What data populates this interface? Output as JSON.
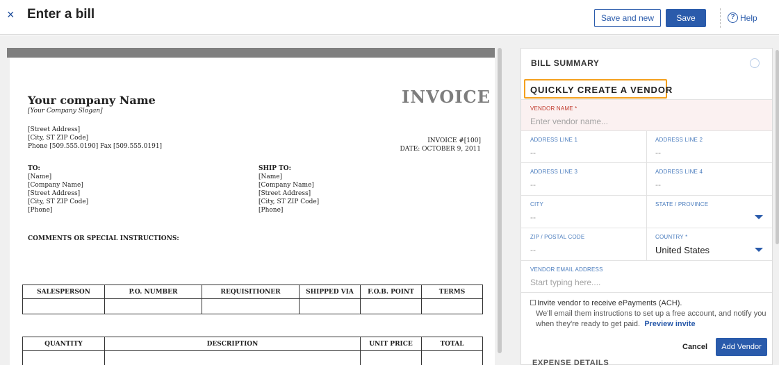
{
  "header": {
    "close_icon": "×",
    "title": "Enter a bill",
    "save_and_new": "Save and new",
    "save": "Save",
    "help": "Help",
    "help_icon": "?"
  },
  "invoice": {
    "company_name": "Your company Name",
    "slogan": "[Your Company Slogan]",
    "title": "INVOICE",
    "street": "[Street Address]",
    "city": "[City, ST  ZIP Code]",
    "phone_fax": "Phone [509.555.0190]  Fax [509.555.0191]",
    "invoice_no": "INVOICE #[100]",
    "date": "DATE: OCTOBER 9, 2011",
    "to": {
      "label": "TO:",
      "lines": [
        "[Name]",
        "[Company Name]",
        "[Street Address]",
        "[City, ST  ZIP Code]",
        "[Phone]"
      ]
    },
    "ship_to": {
      "label": "SHIP TO:",
      "lines": [
        "[Name]",
        "[Company Name]",
        "[Street Address]",
        "[City, ST  ZIP Code]",
        "[Phone]"
      ]
    },
    "comments": "COMMENTS OR SPECIAL INSTRUCTIONS:",
    "table1_headers": [
      "SALESPERSON",
      "P.O. NUMBER",
      "REQUISITIONER",
      "SHIPPED VIA",
      "F.O.B. POINT",
      "TERMS"
    ],
    "table2_headers": [
      "QUANTITY",
      "DESCRIPTION",
      "UNIT PRICE",
      "TOTAL"
    ]
  },
  "form": {
    "bill_summary": "BILL SUMMARY",
    "quick_create": "QUICKLY CREATE A VENDOR",
    "vendor_name_label": "VENDOR NAME *",
    "vendor_name_placeholder": "Enter vendor name...",
    "address1_label": "ADDRESS LINE 1",
    "address1_value": "--",
    "address2_label": "ADDRESS LINE 2",
    "address2_value": "--",
    "address3_label": "ADDRESS LINE 3",
    "address3_value": "--",
    "address4_label": "ADDRESS LINE 4",
    "address4_value": "--",
    "city_label": "CITY",
    "city_value": "--",
    "state_label": "STATE / PROVINCE",
    "zip_label": "ZIP / POSTAL CODE",
    "zip_value": "--",
    "country_label": "COUNTRY *",
    "country_value": "United States",
    "email_label": "VENDOR EMAIL ADDRESS",
    "email_placeholder": "Start typing here....",
    "invite_text": "Invite vendor to receive ePayments (ACH).",
    "invite_sub": "We'll email them instructions to set up a free account, and notify you when they're ready to get paid.",
    "preview_invite": "Preview invite",
    "cancel": "Cancel",
    "add_vendor": "Add Vendor",
    "expense_details": "EXPENSE DETAILS"
  }
}
